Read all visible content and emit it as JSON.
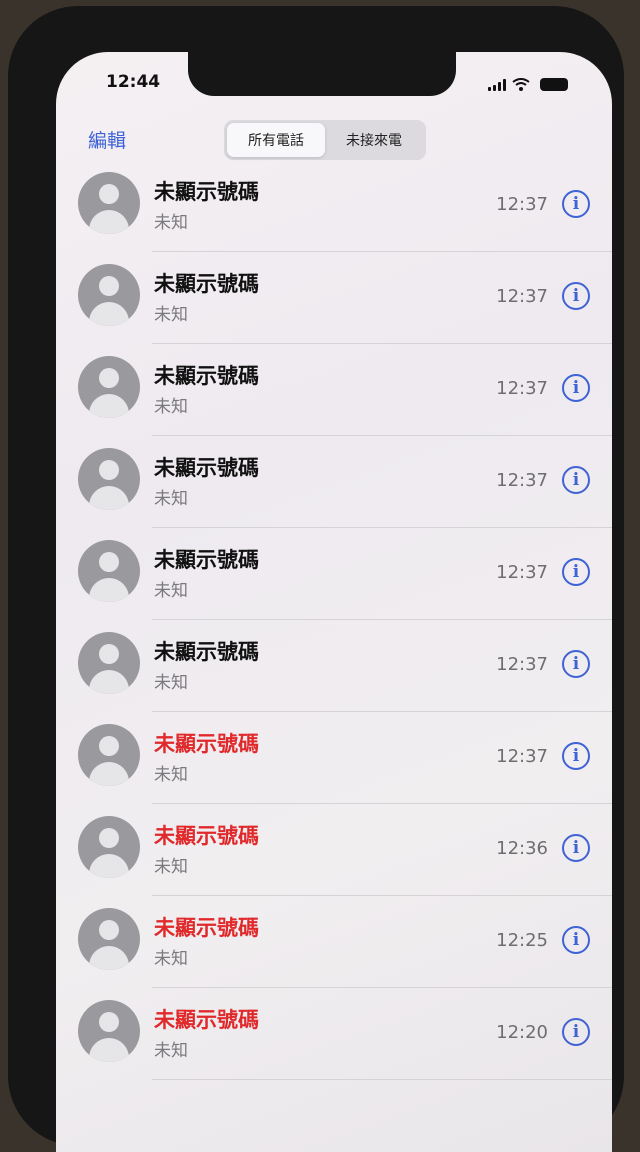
{
  "status_bar": {
    "time": "12:44"
  },
  "nav": {
    "edit_label": "編輯",
    "segments": [
      "所有電話",
      "未接來電"
    ],
    "selected_segment": "所有電話"
  },
  "calls": [
    {
      "name": "未顯示號碼",
      "label": "未知",
      "time": "12:37",
      "missed": false
    },
    {
      "name": "未顯示號碼",
      "label": "未知",
      "time": "12:37",
      "missed": false
    },
    {
      "name": "未顯示號碼",
      "label": "未知",
      "time": "12:37",
      "missed": false
    },
    {
      "name": "未顯示號碼",
      "label": "未知",
      "time": "12:37",
      "missed": false
    },
    {
      "name": "未顯示號碼",
      "label": "未知",
      "time": "12:37",
      "missed": false
    },
    {
      "name": "未顯示號碼",
      "label": "未知",
      "time": "12:37",
      "missed": false
    },
    {
      "name": "未顯示號碼",
      "label": "未知",
      "time": "12:37",
      "missed": true
    },
    {
      "name": "未顯示號碼",
      "label": "未知",
      "time": "12:36",
      "missed": true
    },
    {
      "name": "未顯示號碼",
      "label": "未知",
      "time": "12:25",
      "missed": true
    },
    {
      "name": "未顯示號碼",
      "label": "未知",
      "time": "12:20",
      "missed": true
    }
  ],
  "icons": {
    "info": "info-icon",
    "avatar": "person-icon"
  },
  "colors": {
    "accent": "#3f63d6",
    "missed": "#e0292b"
  }
}
